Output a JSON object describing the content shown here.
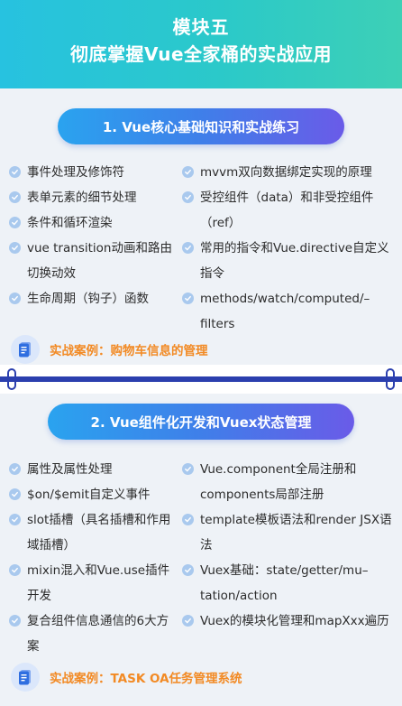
{
  "header": {
    "title": "模块五",
    "subtitle": "彻底掌握Vue全家桶的实战应用"
  },
  "section1": {
    "title": "1. Vue核心基础知识和实战练习",
    "left_items": [
      "事件处理及修饰符",
      "表单元素的细节处理",
      "条件和循环渲染",
      "vue transition动画和路由切换动效",
      "生命周期（钩子）函数"
    ],
    "right_items": [
      "mvvm双向数据绑定实现的原理",
      "受控组件（data）和非受控组件（ref）",
      "常用的指令和Vue.directive自定义指令",
      "methods/watch/computed/–filters"
    ],
    "case": "实战案例：购物车信息的管理"
  },
  "section2": {
    "title": "2. Vue组件化开发和Vuex状态管理",
    "left_items": [
      "属性及属性处理",
      "$on/$emit自定义事件",
      "slot插槽（具名插槽和作用域插槽）",
      "mixin混入和Vue.use插件开发",
      "复合组件信息通信的6大方案"
    ],
    "right_items": [
      "Vue.component全局注册和components局部注册",
      "template模板语法和render JSX语法",
      "Vuex基础：state/getter/mu–tation/action",
      "Vuex的模块化管理和mapXxx遍历"
    ],
    "case": "实战案例：TASK OA任务管理系统"
  },
  "colors": {
    "header_gradient_start": "#27c2e0",
    "header_gradient_end": "#3dd0b6",
    "pill_gradient_start": "#2aa3ef",
    "pill_gradient_end": "#6a5be8",
    "case_text": "#f28a24",
    "divider": "#2b3fae",
    "check": "#a9c9ee"
  },
  "icons": {
    "bullet": "check-circle-icon",
    "case": "document-icon",
    "divider_ends": "clip-ring-icon"
  }
}
